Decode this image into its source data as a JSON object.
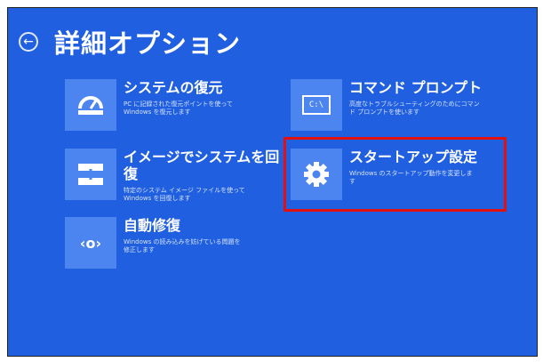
{
  "header": {
    "title": "詳細オプション",
    "back_glyph": "←"
  },
  "options": {
    "restore": {
      "title": "システムの復元",
      "desc": "PC に記録された復元ポイントを使って\nWindows を復元します"
    },
    "command_prompt": {
      "title": "コマンド プロンプト",
      "desc": "高度なトラブルシューティングのためにコマン\nド プロンプトを使います",
      "icon_text": "C:\\"
    },
    "image_recovery": {
      "title": "イメージでシステムを回\n復",
      "desc": "特定のシステム イメージ ファイルを使って\nWindows を回復します"
    },
    "startup_settings": {
      "title": "スタートアップ設定",
      "desc": "Windows のスタートアップ動作を変更しま\nす"
    },
    "startup_repair": {
      "title": "自動修復",
      "desc": "Windows の読み込みを妨げている問題を\n修正します",
      "icon_text": "‹o›"
    }
  },
  "colors": {
    "background": "#1f5fe0",
    "tile": "#4c84f0",
    "highlight": "#e31010"
  }
}
